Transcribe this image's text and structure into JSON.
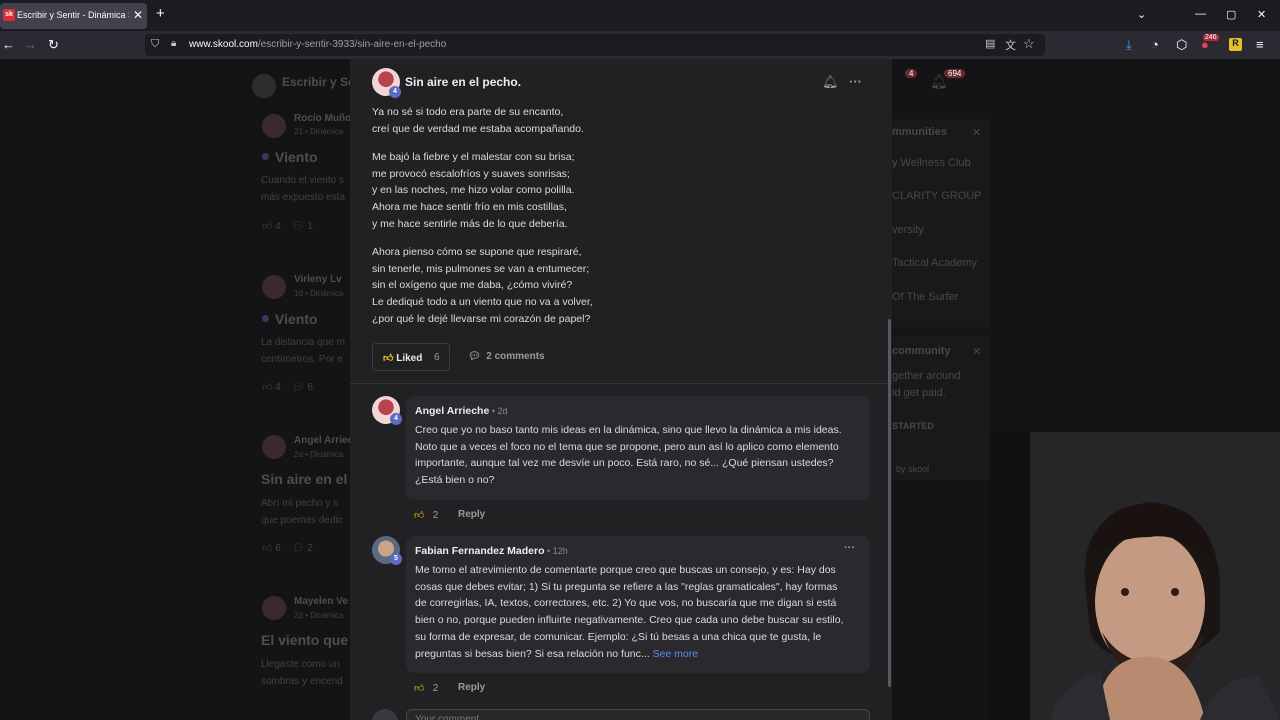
{
  "browser": {
    "tab_title": "Escribir y Sentir - Dinámica Sentir",
    "favicon_text": "sk",
    "url_host": "www.skool.com",
    "url_path": "/escribir-y-sentir-3933/sin-aire-en-el-pecho",
    "ext_badge": "246"
  },
  "background": {
    "group_name": "Escribir y Sentir",
    "notif_count_1": "4",
    "notif_count_2": "694",
    "cards": [
      {
        "author": "Rocío Muñoz",
        "meta": "21 • Dinámica",
        "title": "Viento",
        "text1": "Cuando el viento s",
        "text2": "más expuesto esta",
        "likes": "4",
        "comments": "1"
      },
      {
        "author": "Virleny Lv",
        "meta": "1d • Dinámica",
        "title": "Viento",
        "text1": "La distancia que m",
        "text2": "centímetros. Por e",
        "likes": "4",
        "comments": "6"
      },
      {
        "author": "Angel Arrieche",
        "meta": "2d • Dinámica",
        "title": "Sin aire en el p",
        "text1": "Abrí mi pecho y s",
        "text2": "que poemas dedic",
        "likes": "6",
        "comments": "2"
      },
      {
        "author": "Mayelen Ve",
        "meta": "2d • Dinámica",
        "title": "El viento que n",
        "text1": "Llegaste como un",
        "text2": "sombras y encend",
        "likes": "",
        "comments": ""
      }
    ],
    "sidebar": {
      "heading1": "mmunities",
      "items": [
        "y Wellness Club",
        "CLARITY GROUP",
        "versity",
        "Tactical Academy",
        "Of The Surfer"
      ],
      "heading2": "community",
      "text1": "gether around",
      "text2": "id get paid.",
      "cta": "STARTED",
      "powered": "by skool"
    }
  },
  "post": {
    "title": "Sin aire en el pecho.",
    "author_level": "4",
    "stanzas": [
      [
        "Ya no sé si todo era parte de su encanto,",
        "creí que de verdad me estaba acompañando."
      ],
      [
        "Me bajó la fiebre y el malestar con su brisa;",
        "me provocó escalofríos y suaves sonrisas;",
        "y en las noches, me hizo volar como polilla.",
        "Ahora me hace sentir frío en mis costillas,",
        "y me hace sentirle más de lo que debería."
      ],
      [
        "Ahora pienso cómo se supone que respiraré,",
        "sin tenerle, mis pulmones se van a entumecer;",
        "sin el oxígeno que me daba, ¿cómo viviré?",
        "Le dediqué todo a un viento que no va a volver,",
        "¿por qué le dejé llevarse mi corazón de papel?"
      ]
    ],
    "liked_label": "Liked",
    "like_count": "6",
    "comments_label": "2 comments"
  },
  "comments": [
    {
      "author": "Angel Arrieche",
      "time": " • 2d",
      "level": "4",
      "lines": [
        "Creo que yo no baso tanto mis ideas en la dinámica, sino que llevo la dinámica a mis ideas.",
        "Noto que a veces el foco no el tema que se propone, pero aun así lo aplico como elemento",
        "importante, aunque tal vez me desvíe un poco. Está raro, no sé... ¿Qué piensan ustedes?",
        "¿Está bien o no?"
      ],
      "likes": "2",
      "reply_label": "Reply"
    },
    {
      "author": "Fabian Fernandez Madero",
      "time": " • 12h",
      "level": "5",
      "lines": [
        "Me tomo el atrevimiento de comentarte porque creo que buscas un consejo, y es: Hay dos",
        "cosas que debes evitar; 1) Si tu pregunta se refiere a las \"reglas gramaticales\", hay formas",
        "de corregirlas, IA, textos, correctores, etc. 2) Yo que vos, no buscaría que me digan si está",
        "bien o no, porque pueden influirte negativamente. Creo que cada uno debe buscar su estilo,",
        "su forma de expresar, de comunicar. Ejemplo: ¿Si tú besas a una chica que te gusta, le",
        "preguntas si besas bien? Si esa relación no func..."
      ],
      "see_more": "See more",
      "likes": "2",
      "reply_label": "Reply"
    }
  ],
  "reply_placeholder": "Your comment..."
}
